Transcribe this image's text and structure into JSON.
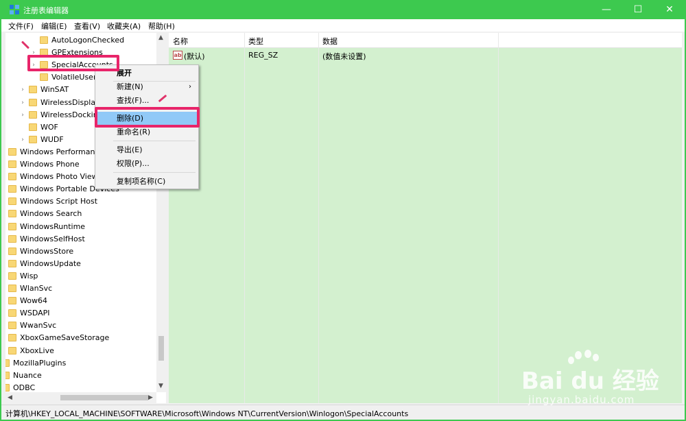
{
  "window": {
    "title": "注册表编辑器",
    "controls": {
      "minimize": "—",
      "maximize": "☐",
      "close": "✕"
    }
  },
  "menubar": {
    "items": [
      "文件(F)",
      "编辑(E)",
      "查看(V)",
      "收藏夹(A)",
      "帮助(H)"
    ]
  },
  "tree": {
    "items": [
      {
        "label": "AutoLogonChecked",
        "indent": 2,
        "expander": false
      },
      {
        "label": "GPExtensions",
        "indent": 2,
        "expander": true
      },
      {
        "label": "SpecialAccounts",
        "indent": 2,
        "expander": true
      },
      {
        "label": "VolatileUser",
        "indent": 2,
        "expander": false
      },
      {
        "label": "WinSAT",
        "indent": 1,
        "expander": true
      },
      {
        "label": "WirelessDisplay",
        "indent": 1,
        "expander": true
      },
      {
        "label": "WirelessDocking",
        "indent": 1,
        "expander": true
      },
      {
        "label": "WOF",
        "indent": 1,
        "expander": false
      },
      {
        "label": "WUDF",
        "indent": 1,
        "expander": true
      },
      {
        "label": "Windows Performance",
        "indent": 0,
        "expander": false
      },
      {
        "label": "Windows Phone",
        "indent": 0,
        "expander": false
      },
      {
        "label": "Windows Photo Viewer",
        "indent": 0,
        "expander": false
      },
      {
        "label": "Windows Portable Devices",
        "indent": 0,
        "expander": false
      },
      {
        "label": "Windows Script Host",
        "indent": 0,
        "expander": false
      },
      {
        "label": "Windows Search",
        "indent": 0,
        "expander": false
      },
      {
        "label": "WindowsRuntime",
        "indent": 0,
        "expander": false
      },
      {
        "label": "WindowsSelfHost",
        "indent": 0,
        "expander": false
      },
      {
        "label": "WindowsStore",
        "indent": 0,
        "expander": false
      },
      {
        "label": "WindowsUpdate",
        "indent": 0,
        "expander": false
      },
      {
        "label": "Wisp",
        "indent": 0,
        "expander": false
      },
      {
        "label": "WlanSvc",
        "indent": 0,
        "expander": false
      },
      {
        "label": "Wow64",
        "indent": 0,
        "expander": false
      },
      {
        "label": "WSDAPI",
        "indent": 0,
        "expander": false
      },
      {
        "label": "WwanSvc",
        "indent": 0,
        "expander": false
      },
      {
        "label": "XboxGameSaveStorage",
        "indent": 0,
        "expander": false
      },
      {
        "label": "XboxLive",
        "indent": 0,
        "expander": false
      },
      {
        "label": "MozillaPlugins",
        "indent": -1,
        "expander": false
      },
      {
        "label": "Nuance",
        "indent": -1,
        "expander": false
      },
      {
        "label": "ODBC",
        "indent": -1,
        "expander": false
      }
    ]
  },
  "list": {
    "columns": [
      "名称",
      "类型",
      "数据"
    ],
    "rows": [
      {
        "name": "(默认)",
        "type": "REG_SZ",
        "data": "(数值未设置)",
        "icon": "ab"
      }
    ]
  },
  "context_menu": {
    "items": [
      {
        "label": "展开",
        "bold": true
      },
      {
        "label": "新建(N)",
        "submenu": true
      },
      {
        "label": "查找(F)..."
      },
      {
        "label": "删除(D)",
        "highlighted": true
      },
      {
        "label": "重命名(R)"
      },
      {
        "label": "导出(E)"
      },
      {
        "label": "权限(P)..."
      },
      {
        "label": "复制项名称(C)"
      }
    ]
  },
  "statusbar": {
    "path": "计算机\\HKEY_LOCAL_MACHINE\\SOFTWARE\\Microsoft\\Windows NT\\CurrentVersion\\Winlogon\\SpecialAccounts"
  },
  "watermark": {
    "brand": "Bai du 经验",
    "url": "jingyan.baidu.com"
  },
  "colors": {
    "title_bar": "#3dc94f",
    "list_bg": "#d3f0cf",
    "highlight_box": "#e8256a",
    "menu_highlight": "#91c9f7"
  }
}
